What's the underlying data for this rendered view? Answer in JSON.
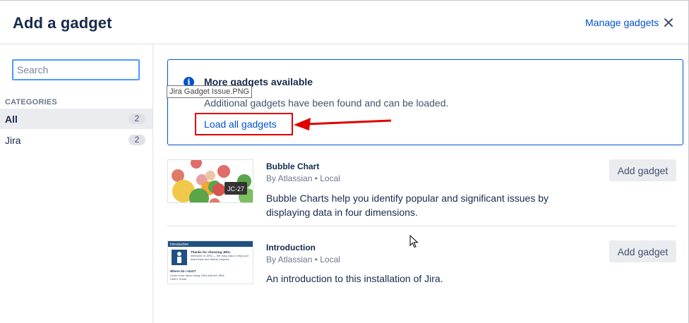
{
  "dialog": {
    "title": "Add a gadget",
    "manage_label": "Manage gadgets"
  },
  "sidebar": {
    "search_placeholder": "Search",
    "categories_heading": "CATEGORIES",
    "categories": [
      {
        "label": "All",
        "count": "2",
        "selected": true
      },
      {
        "label": "Jira",
        "count": "2",
        "selected": false
      }
    ]
  },
  "notice": {
    "icon": "info-icon",
    "title": "More gadgets available",
    "text": "Additional gadgets have been found and can be loaded.",
    "link": "Load all gadgets"
  },
  "tooltip": "Jira Gadget Issue.PNG",
  "gadgets": [
    {
      "title": "Bubble Chart",
      "author": "By Atlassian • Local",
      "description": "Bubble Charts help you identify popular and significant issues by displaying data in four dimensions.",
      "button": "Add gadget",
      "thumb_label": "JC-27"
    },
    {
      "title": "Introduction",
      "author": "By Atlassian • Local",
      "description": "An introduction to this installation of Jira.",
      "button": "Add gadget",
      "thumb_header": "Introduction",
      "thumb_heading": "Thanks for choosing JIRA.",
      "thumb_text": "Welcome to JIRA — the easy way to help your team track and deliver projects.",
      "thumb_subheading": "Where do I start?",
      "thumb_foot": "Learn more about using JIRA with the JIRA User's Guide."
    }
  ],
  "colors": {
    "link": "#0052cc",
    "annotation": "#e00000",
    "selected_bg": "#ebecf0"
  }
}
